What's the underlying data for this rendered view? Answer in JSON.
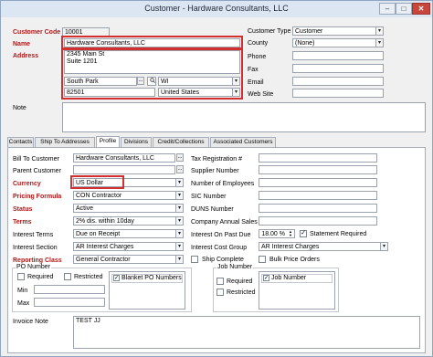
{
  "window": {
    "title": "Customer - Hardware Consultants, LLC",
    "minimize": "–",
    "maximize": "□",
    "close": "✕"
  },
  "top": {
    "customer_code": {
      "label": "Customer Code",
      "value": "10001"
    },
    "name": {
      "label": "Name",
      "value": "Hardware Consultants, LLC"
    },
    "address": {
      "label": "Address",
      "line1": "2345 Main St",
      "line2": "Suite 1201",
      "city": "South Park",
      "state": "WI",
      "zip": "82501",
      "country": "United States",
      "ellipsis": "..."
    },
    "note": {
      "label": "Note"
    },
    "customer_type": {
      "label": "Customer Type",
      "value": "Customer"
    },
    "county": {
      "label": "County",
      "value": "(None)"
    },
    "phone": {
      "label": "Phone"
    },
    "fax": {
      "label": "Fax"
    },
    "email": {
      "label": "Email"
    },
    "website": {
      "label": "Web Site"
    }
  },
  "tabs": [
    "Contacts",
    "Ship To Addresses",
    "Profile",
    "Divisions",
    "Credit/Collections",
    "Associated Customers"
  ],
  "active_tab": "Profile",
  "profile": {
    "bill_to_customer": {
      "label": "Bill To Customer",
      "value": "Hardware Consultants, LLC",
      "ellipsis": "..."
    },
    "parent_customer": {
      "label": "Parent Customer",
      "ellipsis": "..."
    },
    "currency": {
      "label": "Currency",
      "value": "US Dollar"
    },
    "pricing_formula": {
      "label": "Pricing Formula",
      "value": "CON  Contractor"
    },
    "status": {
      "label": "Status",
      "value": "Active"
    },
    "terms": {
      "label": "Terms",
      "value": "2% dis. within 10day"
    },
    "interest_terms": {
      "label": "Interest Terms",
      "value": "Due on Receipt"
    },
    "interest_section": {
      "label": "Interest Section",
      "value": "AR Interest Charges"
    },
    "reporting_class": {
      "label": "Reporting Class",
      "value": "General Contractor"
    },
    "tax_registration": {
      "label": "Tax Registration #"
    },
    "supplier_number": {
      "label": "Supplier Number"
    },
    "number_of_employees": {
      "label": "Number of Employees"
    },
    "sic_number": {
      "label": "SIC Number"
    },
    "duns_number": {
      "label": "DUNS Number"
    },
    "company_annual_sales": {
      "label": "Company Annual Sales"
    },
    "interest_on_past_due": {
      "label": "Interest On Past Due",
      "value": "18.00 %"
    },
    "statement_required": {
      "label": "Statement Required",
      "checked": true
    },
    "interest_cost_group": {
      "label": "Interest Cost Group",
      "value": "AR Interest Charges"
    },
    "ship_complete": {
      "label": "Ship Complete",
      "checked": false
    },
    "bulk_price_orders": {
      "label": "Bulk Price Orders",
      "checked": false
    },
    "po_number": {
      "group": "PO Number",
      "required": "Required",
      "restricted": "Restricted",
      "list_item": "Blanket PO Numbers",
      "min": "Min",
      "max": "Max"
    },
    "job_number": {
      "group": "Job Number",
      "required": "Required",
      "restricted": "Restricted",
      "list_item": "Job Number"
    },
    "invoice_note": {
      "label": "Invoice Note",
      "value": "TEST JJ"
    }
  },
  "icons": {
    "dropdown": "▾",
    "check": "✓",
    "spin_up": "▲",
    "spin_down": "▼"
  }
}
